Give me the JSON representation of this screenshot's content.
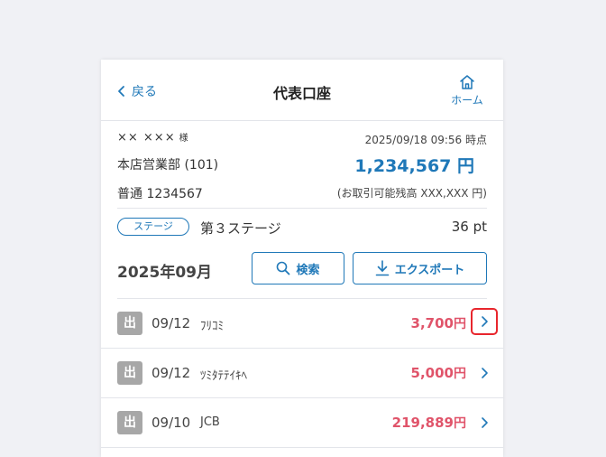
{
  "header": {
    "back_label": "戻る",
    "title": "代表口座",
    "home_label": "ホーム"
  },
  "account": {
    "customer_name": "×× ×××",
    "customer_suffix": "様",
    "timestamp": "2025/09/18 09:56 時点",
    "branch": "本店営業部 (101)",
    "balance": "1,234,567 円",
    "account_number": "普通 1234567",
    "available_balance": "(お取引可能残高 XXX,XXX 円)"
  },
  "stage": {
    "badge": "ステージ",
    "name": "第３ステージ",
    "points": "36 pt"
  },
  "period": {
    "label": "2025年09月",
    "search_label": "検索",
    "export_label": "エクスポート"
  },
  "transactions": [
    {
      "kind": "出",
      "date": "09/12",
      "description": "ﾌﾘｺﾐ",
      "amount": "3,700",
      "unit": "円"
    },
    {
      "kind": "出",
      "date": "09/12",
      "description": "ﾂﾐﾀﾃﾃｲｷﾍ",
      "amount": "5,000",
      "unit": "円"
    },
    {
      "kind": "出",
      "date": "09/10",
      "description": "JCB",
      "amount": "219,889",
      "unit": "円"
    }
  ],
  "colors": {
    "accent": "#1f78b8",
    "debit_amount": "#e0546a",
    "highlight": "#e8262d",
    "badge_bg": "#a7a7a7"
  }
}
